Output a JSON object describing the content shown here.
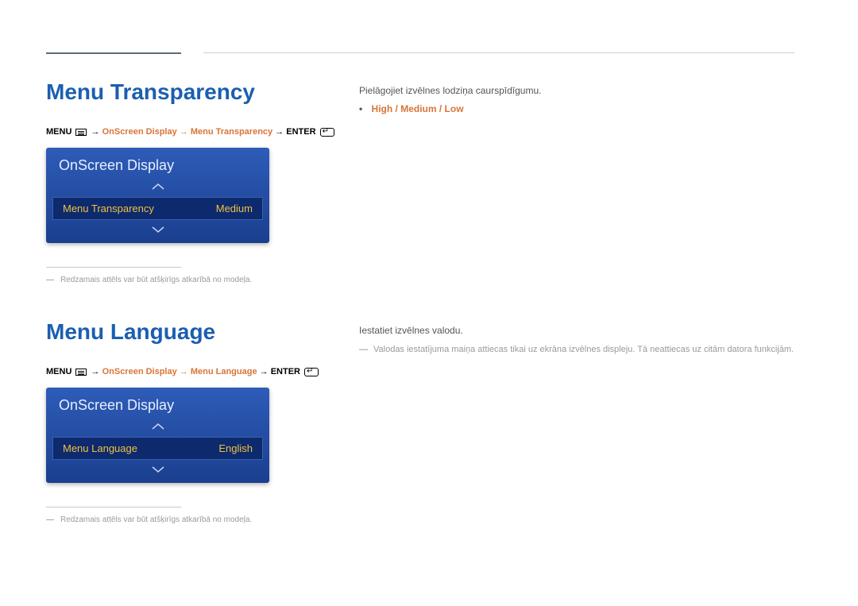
{
  "section1": {
    "title": "Menu Transparency",
    "breadcrumb": {
      "menu": "MENU",
      "path": "OnScreen Display → Menu Transparency",
      "enter": "ENTER"
    },
    "panel": {
      "header": "OnScreen Display",
      "label": "Menu Transparency",
      "value": "Medium"
    },
    "footnote": "Redzamais attēls var būt atšķirīgs atkarībā no modeļa.",
    "right": {
      "desc": "Pielāgojiet izvēlnes lodziņa caurspīdīgumu.",
      "options": "High / Medium / Low"
    }
  },
  "section2": {
    "title": "Menu Language",
    "breadcrumb": {
      "menu": "MENU",
      "path": "OnScreen Display → Menu Language",
      "enter": "ENTER"
    },
    "panel": {
      "header": "OnScreen Display",
      "label": "Menu Language",
      "value": "English"
    },
    "footnote": "Redzamais attēls var būt atšķirīgs atkarībā no modeļa.",
    "right": {
      "desc": "Iestatiet izvēlnes valodu.",
      "note": "Valodas iestatījuma maiņa attiecas tikai uz ekrāna izvēlnes displeju. Tā neattiecas uz citām datora funkcijām."
    }
  },
  "arrow": "→"
}
